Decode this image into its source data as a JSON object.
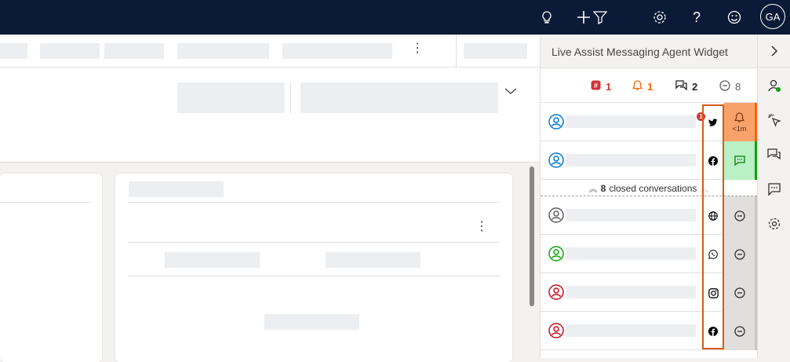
{
  "topbar": {
    "icons": [
      "lightbulb-icon",
      "plus-icon",
      "filter-icon",
      "gear-icon",
      "help-icon",
      "smiley-icon"
    ],
    "avatar_initials": "GA"
  },
  "widget": {
    "title": "Live Assist Messaging Agent Widget",
    "stats": {
      "urgent_count": "1",
      "alert_count": "1",
      "active_count": "2",
      "closed_count": "8"
    },
    "closed_bar": {
      "count": "8",
      "label": "closed conversations"
    },
    "conversations": [
      {
        "channel": "twitter",
        "person_color": "#0078d4",
        "status": "alert",
        "status_time": "<1m",
        "unread": "1"
      },
      {
        "channel": "facebook",
        "person_color": "#0078d4",
        "status": "active"
      },
      {
        "channel": "web",
        "person_color": "#605e5c",
        "status": "closed"
      },
      {
        "channel": "whatsapp",
        "person_color": "#13a10e",
        "status": "closed"
      },
      {
        "channel": "instagram",
        "person_color": "#c50f1f",
        "status": "closed"
      },
      {
        "channel": "facebook",
        "person_color": "#c50f1f",
        "status": "closed"
      }
    ]
  },
  "colors": {
    "topbar_bg": "#0b1a37",
    "urgent": "#d13438",
    "alert": "#f7630c",
    "alert_bg": "#f7a26b",
    "active_bg": "#b9f0c4",
    "active_bar": "#13a10e",
    "highlight_frame": "#d85a13"
  }
}
